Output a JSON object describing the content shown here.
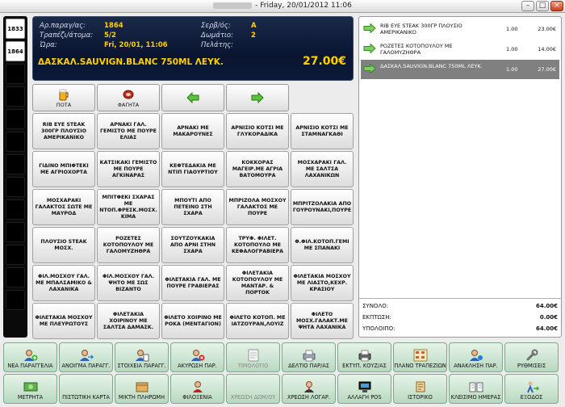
{
  "window": {
    "title": "- Friday, 20/01/2012 11:06",
    "minimize": "–",
    "maximize": "□",
    "close": "×"
  },
  "tables": [
    "1833",
    "1864"
  ],
  "header": {
    "order_label": "Αρ.παραγ/ας:",
    "order_value": "1864",
    "table_label": "Τραπέζι/άτομα:",
    "table_value": "5/2",
    "time_label": "Ώρα:",
    "time_value": "Fri, 20/01, 11:06",
    "waiter_label": "Σερβ/ός:",
    "waiter_value": "A",
    "room_label": "Δωμάτιο:",
    "room_value": "2",
    "customer_label": "Πελάτης:",
    "customer_value": "",
    "selected_product": "ΔΑΣΚΑΛ.SAUVIGN.BLANC 750ML ΛΕΥΚ.",
    "selected_price": "27.00€"
  },
  "categories": [
    {
      "label": "ΠΟΤΑ",
      "icon": "beer-icon"
    },
    {
      "label": "ΦΑΓΗΤΑ",
      "icon": "meat-icon"
    },
    {
      "label": "",
      "icon": "arrow-left-icon"
    },
    {
      "label": "",
      "icon": "arrow-right-icon"
    }
  ],
  "products": [
    [
      "RIB EYE STEAK 300ΓΡ ΠΛΟΥΣΙΟ ΑΜΕΡΙΚΑΝΙΚΟ",
      "ΑΡΝΑΚΙ ΓΑΛ. ΓΕΜΙΣΤΟ ΜΕ ΠΟΥΡΕ ΕΛΙΑΣ",
      "ΑΡΝΑΚΙ ΜΕ ΜΑΚΑΡΟΥΝΕΣ",
      "ΑΡΝΙΣΙΟ ΚΟΤΣΙ ΜΕ ΓΛΥΚΟΡΑΔΙΚΑ",
      "ΑΡΝΙΣΙΟ ΚΟΤΣΙ ΜΕ ΣΤΑΜΝΑΓΚΑΘΙ"
    ],
    [
      "ΓΙΔΙΝΟ ΜΠΙΦΤΕΚΙ ΜΕ ΑΓΡΙΟΧΟΡΤΑ",
      "ΚΑΤΣΙΚΑΚΙ ΓΕΜΙΣΤΟ ΜΕ ΠΟΥΡΕ ΑΓΚΙΝΑΡΑΣ",
      "ΚΕΦΤΕΔΑΚΙΑ ΜΕ ΝΤΙΠ ΓΙΑΟΥΡΤΙΟΥ",
      "ΚΟΚΚΟΡΑΣ ΜΑΓΕΙΡ.ΜΕ ΑΓΡΙΑ ΒΑΤΟΜΟΥΡΑ",
      "ΜΟΣΧΑΡΑΚΙ ΓΑΛ. ΜΕ ΣΑΛΤΣΑ ΛΑΧΑΝΙΚΩΝ"
    ],
    [
      "ΜΟΣΧΑΡΑΚΙ ΓΑΛΑΚΤΟΣ ΣΩΤΕ ΜΕ ΜΑΥΡΟΔ",
      "ΜΠΙΤΦΕΚΙ ΣΧΑΡΑΣ ΜΕ ΝΤΟΠ.ΦΡΕΣΚ.ΜΟΣΧ. ΚΙΜΑ",
      "ΜΠΟΥΤΙ ΑΠΟ ΠΕΤΕΙΝΟ ΣΤΗ ΣΧΑΡΑ",
      "ΜΠΡΙΖΟΛΑ ΜΟΣΧΟΥ ΓΑΛΑΚΤΟΣ ΜΕ ΠΟΥΡΕ",
      "ΜΠΡΙΤΖΟΛΑΚΙΑ ΑΠΟ ΓΟΥΡΟΥΝΑΚΙ,ΠΟΥΡΕ"
    ],
    [
      "ΠΛΟΥΣΙΟ STEAK ΜΟΣΧ.",
      "ΡΟΖΕΤΕΣ ΚΟΤΟΠΟΥΛΟΥ ΜΕ ΓΑΛΟΜΥΖΗΘΡΑ",
      "ΣΟΥΤΖΟΥΚΑΚΙΑ ΑΠΟ ΑΡΝΙ ΣΤΗΝ ΣΧΑΡΑ",
      "ΤΡΥΦ. ΦΙΛΕΤ. ΚΟΤΟΠΟΥΛΟ ΜΕ ΚΕΦΑΛΟΓΡΑΒΙΕΡΑ",
      "Φ.ΦΙΛ.ΚΟΤΟΠ.ΓΕΜΙ ΜΕ ΣΠΑΝΑΚΙ"
    ],
    [
      "ΦΙΛ.ΜΟΣΧΟΥ ΓΑΛ. ΜΕ ΜΠΑΛΣΑΜΙΚΟ & ΛΑΧΑΝΙΚΑ",
      "ΦΙΛ.ΜΟΣΧΟΥ ΓΑΛ. ΨΗΤΟ ΜΕ ΣΩΣ ΒΙΖΑΝΤΟ",
      "ΦΙΛΕΤΑΚΙΑ ΓΑΛ. ΜΕ ΠΟΥΡΕ ΓΡΑΒΙΕΡΑΣ",
      "ΦΙΛΕΤΑΚΙΑ ΚΟΤΟΠΟΥΛΟΥ ΜΕ ΜΑΝΤΑΡ. & ΠΟΡΤΟΚ",
      "ΦΙΛΕΤΑΚΙΑ ΜΟΣΧΟΥ ΜΕ ΛΙΑΣΤΟ,ΚΕΧΡ. ΚΡΑΣΙΟΥ"
    ],
    [
      "ΦΙΛΕΤΑΚΙΑ ΜΟΣΧΟΥ ΜΕ ΠΛΕΥΡΩΤΟΥΣ",
      "ΦΙΛΕΤΑΚΙΑ ΧΟΙΡΙΝΟΥ ΜΕ ΣΑΛΤΣΑ ΔΑΜΑΣΚ.",
      "ΦΙΛΕΤΟ ΧΟΙΡΙΝΟ ΜΕ ΡΟΚΑ (ΜΕΝΤΑΓΙΟΝ)",
      "ΦΙΛΕΤΟ ΚΟΤΟΠ. ΜΕ ΙΑΤΖΟΥΡΑΝ,ΛΟΥΙΖ",
      "ΦΙΛΕΤΟ ΜΟΣΧ.ΓΑΛΑΚΤ.ΜΕ ΨΗΤΑ ΛΑΧΑΝΙΚΑ"
    ]
  ],
  "order_items": [
    {
      "name": "RIB EYE STEAK 300ΓΡ ΠΛΟΥΣΙΟ ΑΜΕΡΙΚΑΝΙΚΟ",
      "qty": "1.00",
      "price": "23.00€"
    },
    {
      "name": "ΡΟΖΕΤΕΣ ΚΟΤΟΠΟΥΛΟΥ ΜΕ ΓΑΛΟΜΥΖΗΘΡΑ",
      "qty": "1.00",
      "price": "14.00€"
    },
    {
      "name": "ΔΑΣΚΑΛ.SAUVIGN.BLANC 750ML ΛΕΥΚ.",
      "qty": "1.00",
      "price": "27.00€"
    }
  ],
  "totals": {
    "total_label": "ΣΥΝΟΛΟ:",
    "total_value": "64.00€",
    "discount_label": "ΕΚΠΤΩΣΗ:",
    "discount_value": "0.00€",
    "balance_label": "ΥΠΟΛΟΙΠΟ:",
    "balance_value": "64.00€"
  },
  "functions_row1": [
    {
      "label": "ΝΕΑ ΠΑΡΑΓΓΕΛΙΑ",
      "icon": "new-order-icon"
    },
    {
      "label": "ΑΝΟΙΓΜΑ ΠΑΡΑΓΓ.",
      "icon": "open-order-icon"
    },
    {
      "label": "ΣΤΟΙΧΕΙΑ ΠΑΡΑΓΓ.",
      "icon": "order-details-icon"
    },
    {
      "label": "ΑΚΥΡΩΣΗ ΠΑΡ.",
      "icon": "cancel-order-icon"
    },
    {
      "label": "ΤΙΜΟΛΟΓΙΟ",
      "icon": "invoice-icon"
    },
    {
      "label": "ΔΕΛΤΙΟ ΠΑΡ/ΑΣ",
      "icon": "delivery-note-icon"
    },
    {
      "label": "ΕΚΤΥΠ. ΚΟΥΖ/ΑΣ",
      "icon": "kitchen-print-icon"
    },
    {
      "label": "ΠΛΑΝΟ ΤΡΑΠΕΖΙΩΝ",
      "icon": "table-plan-icon"
    },
    {
      "label": "ΑΝΑΚΛΗΣΗ ΠΑΡ.",
      "icon": "recall-order-icon"
    },
    {
      "label": "ΡΥΘΜΙΣΕΙΣ",
      "icon": "wrench-icon"
    }
  ],
  "functions_row2": [
    {
      "label": "ΜΕΤΡΗΤΑ",
      "icon": "cash-icon"
    },
    {
      "label": "ΠΙΣΤΩΤΙΚΗ ΚΑΡΤΑ",
      "icon": "credit-card-icon"
    },
    {
      "label": "ΜΙΚΤΗ ΠΛΗΡΩΜΗ",
      "icon": "mixed-payment-icon"
    },
    {
      "label": "ΦΙΛΟΞΕΝΙΑ",
      "icon": "hospitality-icon"
    },
    {
      "label": "ΧΡΕΩΣΗ ΔΩΜ/ΟΥ",
      "icon": "room-charge-icon"
    },
    {
      "label": "ΧΡΕΩΣΗ ΛΟΓΑΡ.",
      "icon": "account-charge-icon"
    },
    {
      "label": "ΑΛΛΑΓΗ POS",
      "icon": "change-pos-icon"
    },
    {
      "label": "ΙΣΤΟΡΙΚΟ",
      "icon": "history-icon"
    },
    {
      "label": "ΚΛΕΙΣΙΜΟ ΗΜΕΡΑΣ",
      "icon": "close-day-icon"
    },
    {
      "label": "ΕΞΟΔΟΣ",
      "icon": "exit-icon"
    }
  ]
}
